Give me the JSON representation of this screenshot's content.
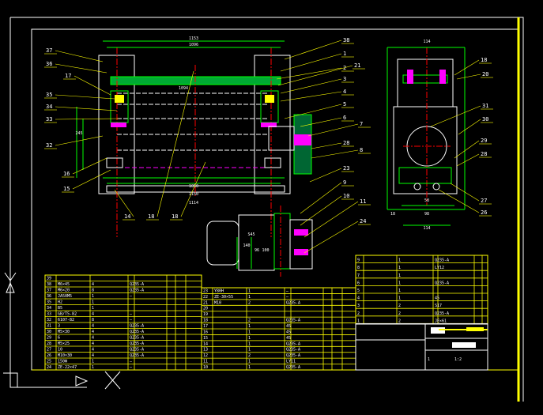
{
  "colors": {
    "background": "#000000",
    "frame": "#ffffff",
    "table": "#ffff00",
    "outline": "#00ff00",
    "center": "#ff0000",
    "hatch": "#ff00ff",
    "leader": "#ffff00",
    "part": "#00ffff"
  },
  "balloons_left": [
    "37",
    "36",
    "17",
    "35",
    "34",
    "33",
    "32",
    "16",
    "15"
  ],
  "balloons_right": [
    "38",
    "1",
    "2",
    "21",
    "3",
    "4",
    "5",
    "6",
    "7",
    "28",
    "8",
    "23",
    "9",
    "10",
    "11",
    "24",
    "25"
  ],
  "balloons_bottom": [
    "14",
    "18",
    "18"
  ],
  "balloons_side": [
    "18",
    "20",
    "31",
    "30",
    "29",
    "28",
    "27",
    "26"
  ],
  "dims": {
    "top_total": "1153",
    "top_inner": "1096",
    "inner_span": "1094",
    "height": "245",
    "bottom_inner": "1050",
    "bottom_total": "1150",
    "bottom_span": "1114",
    "side_top": "114",
    "side_bottom": "114",
    "side_mid": "98",
    "side_small": "58",
    "side_left": "18",
    "motor_a": "140",
    "motor_b": "S45",
    "motor_c": "96",
    "motor_d": "100"
  },
  "table_left": [
    {
      "no": "39",
      "name": "",
      "qty": "",
      "mat": ""
    },
    {
      "no": "38",
      "name": "M6×45",
      "qty": "4",
      "mat": "Q235-A"
    },
    {
      "no": "37",
      "name": "M6×20",
      "qty": "8",
      "mat": "Q235-A"
    },
    {
      "no": "36",
      "name": "JA50M5",
      "qty": "1",
      "mat": "—"
    },
    {
      "no": "35",
      "name": "H2",
      "qty": "1",
      "mat": ""
    },
    {
      "no": "34",
      "name": "B5",
      "qty": "1",
      "mat": ""
    },
    {
      "no": "33",
      "name": "GB/T5-82",
      "qty": "4",
      "mat": "—"
    },
    {
      "no": "32",
      "name": "6107-82",
      "qty": "8",
      "mat": "—"
    },
    {
      "no": "31",
      "name": "3",
      "qty": "4",
      "mat": "Q235-A"
    },
    {
      "no": "30",
      "name": "M5×30",
      "qty": "4",
      "mat": "Q235-A"
    },
    {
      "no": "29",
      "name": "6",
      "qty": "4",
      "mat": "Q235-A"
    },
    {
      "no": "28",
      "name": "M5×25",
      "qty": "4",
      "mat": "Q235-A"
    },
    {
      "no": "27",
      "name": "10",
      "qty": "4",
      "mat": "Q235-A"
    },
    {
      "no": "26",
      "name": "M10×30",
      "qty": "4",
      "mat": "Q235-A"
    },
    {
      "no": "25",
      "name": "150W",
      "qty": "1",
      "mat": "—"
    },
    {
      "no": "24",
      "name": "ZE-22×47",
      "qty": "1",
      "mat": "—"
    }
  ],
  "table_mid": [
    {
      "no": "23",
      "name": "Y80H",
      "qty": "1",
      "mat": "—"
    },
    {
      "no": "22",
      "name": "ZE-30×55",
      "qty": "1",
      "mat": "—"
    },
    {
      "no": "21",
      "name": "M10",
      "qty": "2",
      "mat": "Q235-A"
    },
    {
      "no": "20",
      "name": "",
      "qty": "",
      "mat": ""
    },
    {
      "no": "19",
      "name": "",
      "qty": "",
      "mat": ""
    },
    {
      "no": "18",
      "name": "",
      "qty": "2",
      "mat": "Q235-A"
    },
    {
      "no": "17",
      "name": "",
      "qty": "1",
      "mat": "45"
    },
    {
      "no": "16",
      "name": "",
      "qty": "1",
      "mat": "45"
    },
    {
      "no": "15",
      "name": "",
      "qty": "1",
      "mat": "45"
    },
    {
      "no": "14",
      "name": "",
      "qty": "1",
      "mat": "Q235-A"
    },
    {
      "no": "13",
      "name": "",
      "qty": "1",
      "mat": "Q235-A"
    },
    {
      "no": "12",
      "name": "",
      "qty": "2",
      "mat": "Q235-A"
    },
    {
      "no": "11",
      "name": "",
      "qty": "1",
      "mat": "LY11"
    },
    {
      "no": "10",
      "name": "",
      "qty": "1",
      "mat": "Q235-A"
    }
  ],
  "table_right": [
    {
      "no": "9",
      "name": "",
      "qty": "1",
      "mat": "Q235-A"
    },
    {
      "no": "8",
      "name": "",
      "qty": "1",
      "mat": "LY12"
    },
    {
      "no": "7",
      "name": "",
      "qty": "1",
      "mat": ""
    },
    {
      "no": "6",
      "name": "",
      "qty": "1",
      "mat": "Q235-A"
    },
    {
      "no": "5",
      "name": "",
      "qty": "1",
      "mat": ""
    },
    {
      "no": "4",
      "name": "",
      "qty": "1",
      "mat": "45"
    },
    {
      "no": "3",
      "name": "",
      "qty": "2",
      "mat": "S17"
    },
    {
      "no": "2",
      "name": "",
      "qty": "2",
      "mat": "Q235-A"
    },
    {
      "no": "1",
      "name": "",
      "qty": "2",
      "mat": "JE×61"
    }
  ],
  "title_block": {
    "scale": "1:2",
    "sheet": "1"
  }
}
